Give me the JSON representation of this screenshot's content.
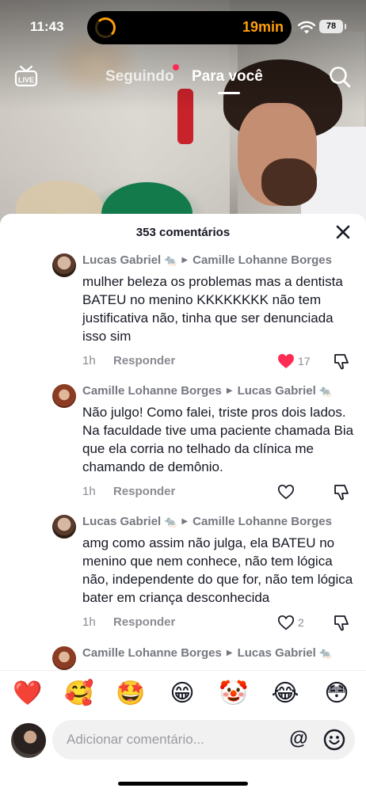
{
  "status_bar": {
    "time": "11:43",
    "timer": "19min",
    "battery": "78"
  },
  "top_nav": {
    "following": "Seguindo",
    "for_you": "Para você"
  },
  "comments_sheet": {
    "title": "353 comentários",
    "comments": [
      {
        "author": "Lucas Gabriel",
        "author_emoji": "🐀",
        "reply_to": "Camille Lohanne Borges",
        "reply_to_emoji": "",
        "text": "mulher beleza os problemas mas a dentista BATEU no menino KKKKKKKK não tem justificativa não, tinha que ser denunciada isso sim",
        "time": "1h",
        "reply_label": "Responder",
        "likes": "17",
        "liked": true
      },
      {
        "author": "Camille Lohanne Borges",
        "author_emoji": "",
        "reply_to": "Lucas Gabriel",
        "reply_to_emoji": "🐀",
        "text": "Não julgo! Como falei, triste pros dois lados. Na faculdade tive uma paciente chamada Bia que ela corria no telhado da clínica me chamando de demônio.",
        "time": "1h",
        "reply_label": "Responder",
        "likes": "",
        "liked": false
      },
      {
        "author": "Lucas Gabriel",
        "author_emoji": "🐀",
        "reply_to": "Camille Lohanne Borges",
        "reply_to_emoji": "",
        "text": "amg como assim não julga, ela BATEU no menino que nem conhece, não tem lógica não, independente do que for, não tem lógica bater em criança desconhecida",
        "time": "1h",
        "reply_label": "Responder",
        "likes": "2",
        "liked": false
      },
      {
        "author": "Camille Lohanne Borges",
        "author_emoji": "",
        "reply_to": "Lucas Gabriel",
        "reply_to_emoji": "🐀",
        "text": "",
        "time": "",
        "reply_label": "",
        "likes": "",
        "liked": false
      }
    ]
  },
  "reactions": [
    "❤️",
    "🥰",
    "🤩",
    "😁",
    "🤡",
    "😂",
    "😳"
  ],
  "comment_input": {
    "placeholder": "Adicionar comentário..."
  },
  "colors": {
    "accent": "#fe2c55",
    "timer": "#ff9f0a"
  }
}
